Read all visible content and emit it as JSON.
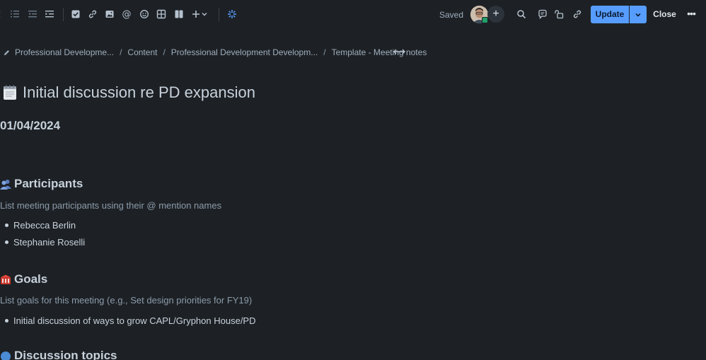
{
  "toolbar": {
    "tools": [
      {
        "icon": "bullet-list-icon"
      },
      {
        "icon": "numbered-list-icon"
      },
      {
        "icon": "outdent-icon"
      },
      {
        "icon": "indent-icon"
      },
      {
        "icon": "task-checkbox-icon"
      },
      {
        "icon": "link-icon"
      },
      {
        "icon": "image-icon"
      },
      {
        "icon": "mention-icon",
        "glyph": "@"
      },
      {
        "icon": "emoji-icon"
      },
      {
        "icon": "table-icon"
      },
      {
        "icon": "layout-columns-icon"
      },
      {
        "icon": "insert-plus-icon"
      },
      {
        "icon": "ai-sparkle-icon"
      }
    ],
    "saved_label": "Saved",
    "add_collaborator_glyph": "+",
    "update_label": "Update",
    "close_label": "Close",
    "more_glyph": "•••",
    "accent_color": "#579dff"
  },
  "breadcrumb": {
    "items": [
      "Professional Developme...",
      "Content",
      "Professional Development Developm...",
      "Template - Meeting notes"
    ],
    "separator": "/"
  },
  "page": {
    "title": "Initial discussion re PD expansion",
    "date": "01/04/2024"
  },
  "sections": {
    "participants": {
      "heading": "Participants",
      "hint": "List meeting participants using their @ mention names",
      "items": [
        "Rebecca Berlin",
        "Stephanie Roselli"
      ]
    },
    "goals": {
      "heading": "Goals",
      "hint": "List goals for this meeting (e.g., Set design priorities for FY19)",
      "items": [
        "Initial discussion of ways to grow CAPL/Gryphon House/PD"
      ]
    },
    "discussion": {
      "heading": "Discussion topics"
    }
  }
}
